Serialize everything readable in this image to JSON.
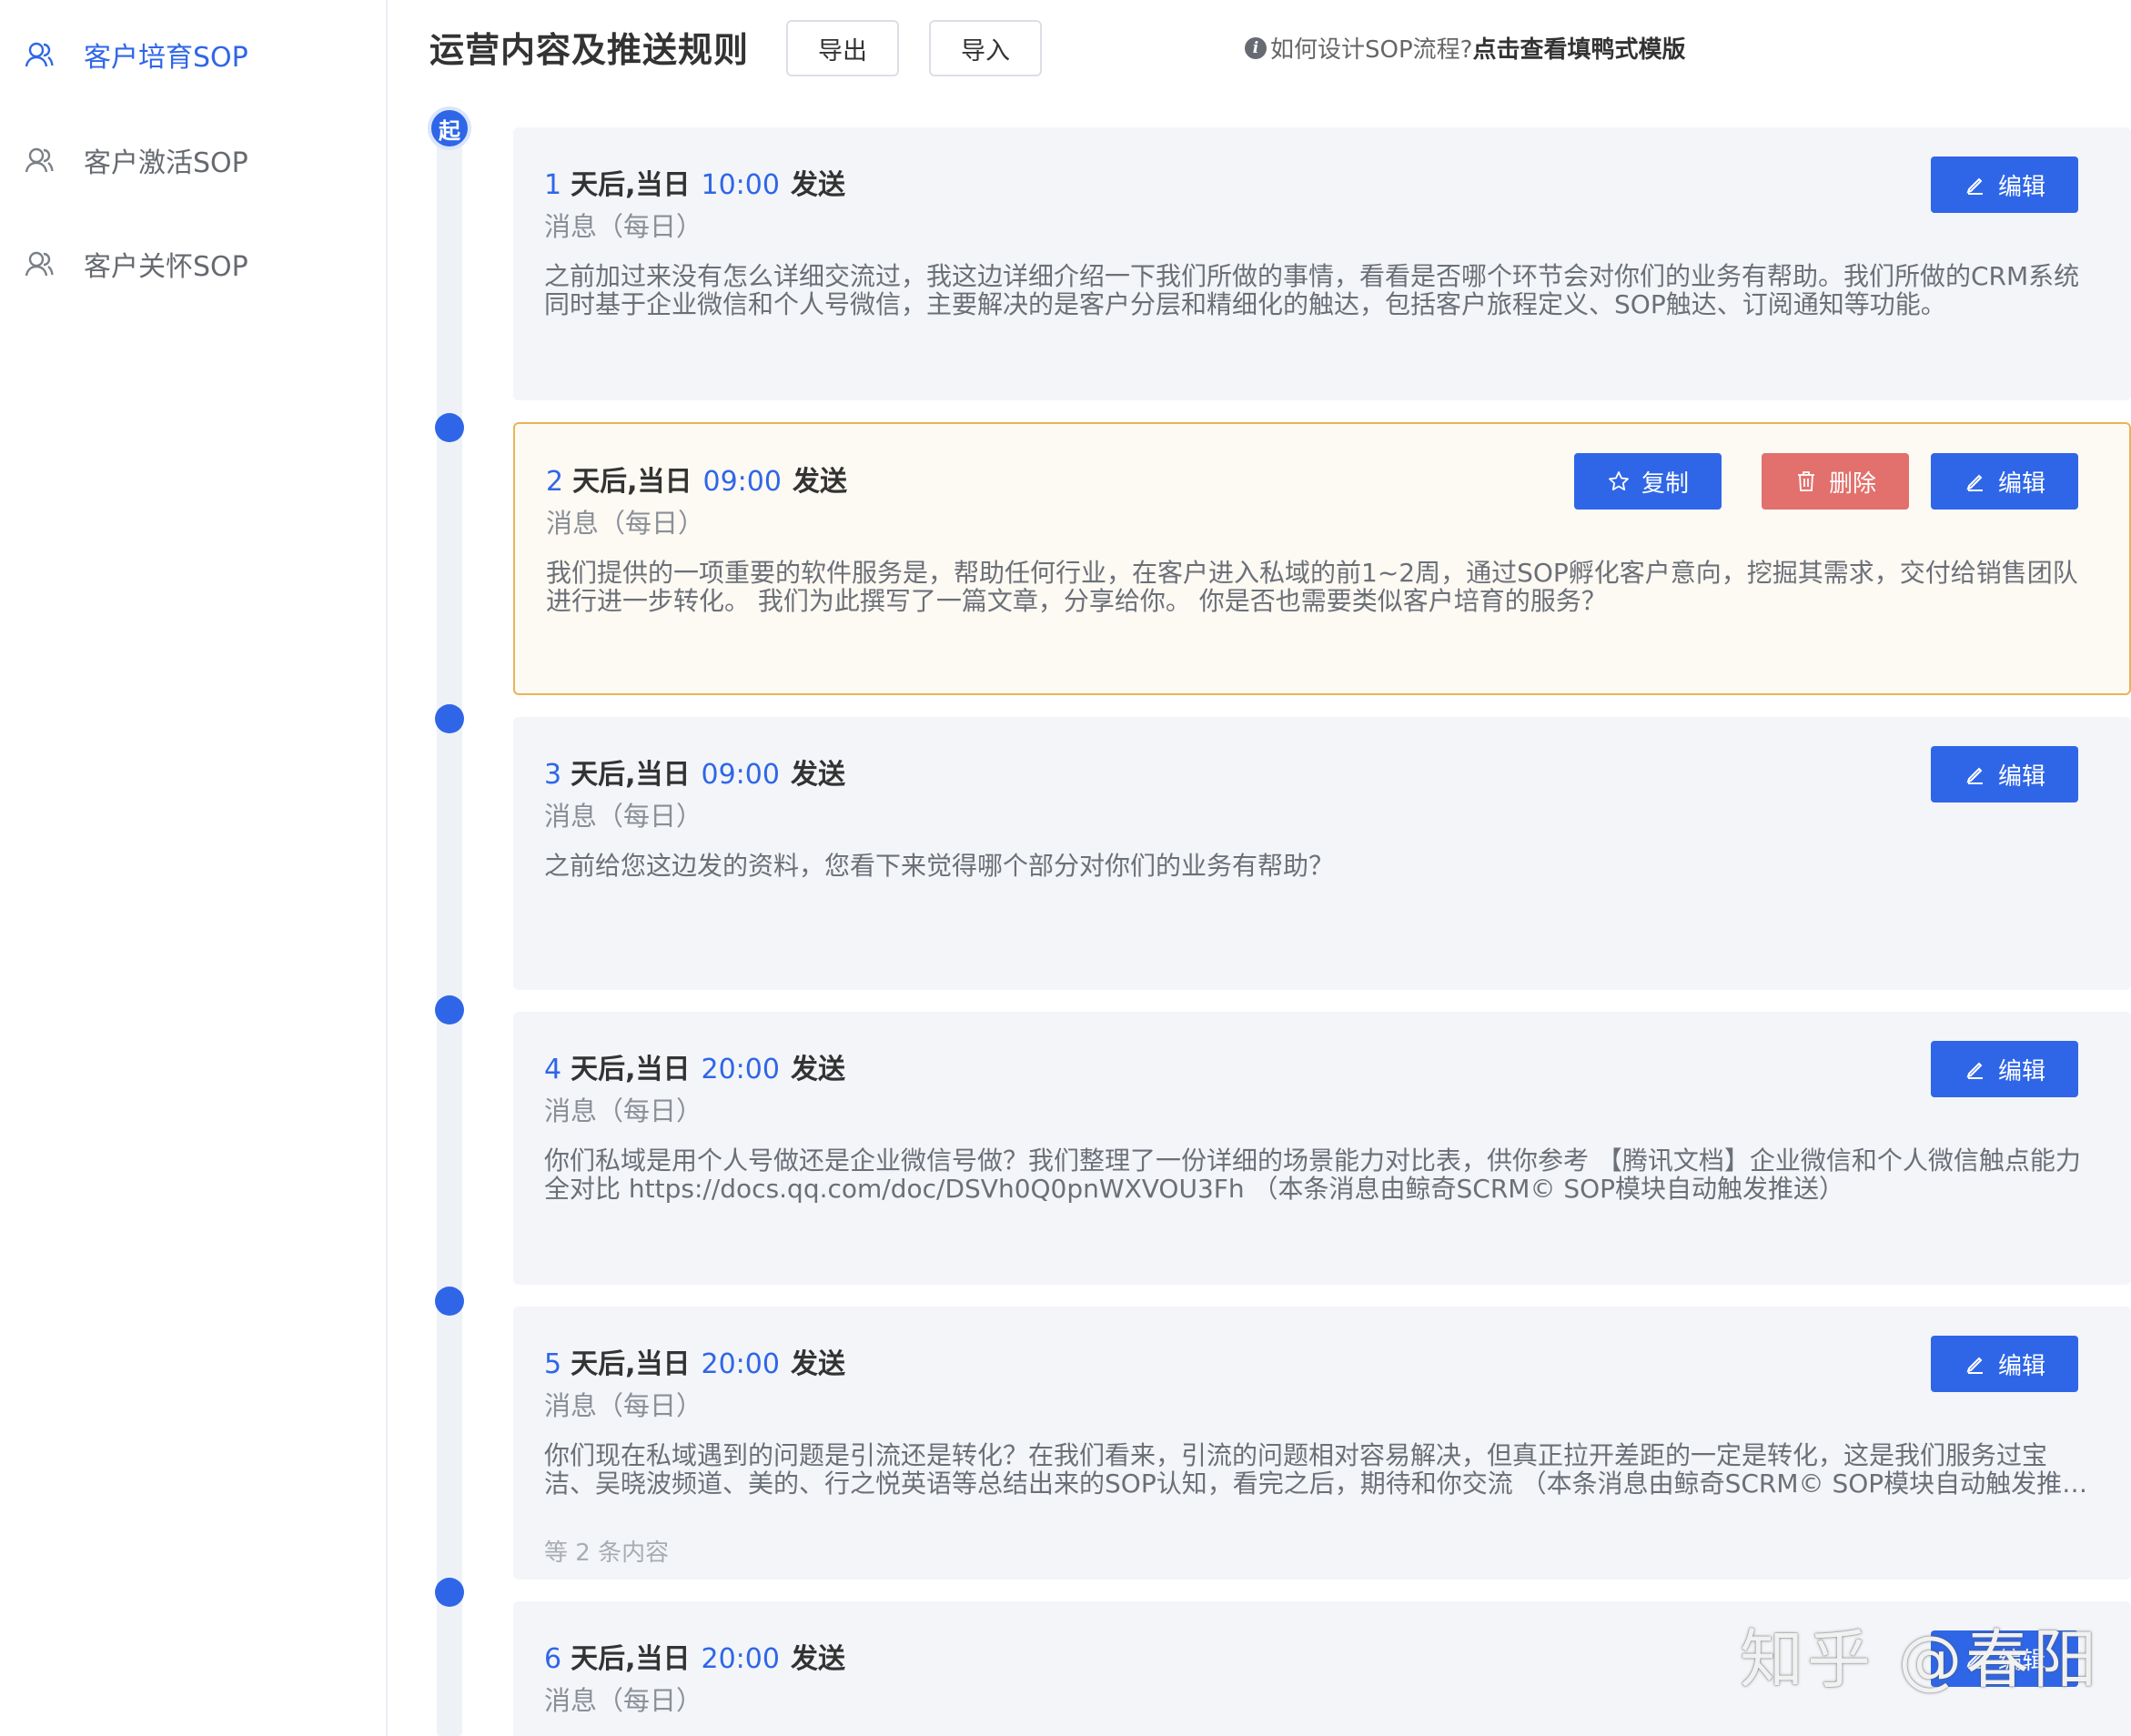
{
  "sidebar": {
    "items": [
      {
        "label": "客户培育SOP",
        "icon": "users-icon",
        "active": true
      },
      {
        "label": "客户激活SOP",
        "icon": "users-icon",
        "active": false
      },
      {
        "label": "客户关怀SOP",
        "icon": "users-icon",
        "active": false
      }
    ]
  },
  "header": {
    "title": "运营内容及推送规则",
    "export_label": "导出",
    "import_label": "导入",
    "hint_text": "如何设计SOP流程?",
    "hint_link": "点击查看填鸭式模版"
  },
  "timeline": {
    "start_label": "起",
    "cards": [
      {
        "num": "1",
        "days_text": "天后,当日",
        "time": "10:00",
        "send": "发送",
        "type": "消息（每日）",
        "content": "之前加过来没有怎么详细交流过，我这边详细介绍一下我们所做的事情，看看是否哪个环节会对你们的业务有帮助。我们所做的CRM系统同时基于企业微信和个人号微信，主要解决的是客户分层和精细化的触达，包括客户旅程定义、SOP触达、订阅通知等功能。",
        "edit_label": "编辑"
      },
      {
        "num": "2",
        "days_text": "天后,当日",
        "time": "09:00",
        "send": "发送",
        "type": "消息（每日）",
        "content": "我们提供的一项重要的软件服务是，帮助任何行业，在客户进入私域的前1~2周，通过SOP孵化客户意向，挖掘其需求，交付给销售团队进行进一步转化。 我们为此撰写了一篇文章，分享给你。 你是否也需要类似客户培育的服务？",
        "copy_label": "复制",
        "delete_label": "删除",
        "edit_label": "编辑"
      },
      {
        "num": "3",
        "days_text": "天后,当日",
        "time": "09:00",
        "send": "发送",
        "type": "消息（每日）",
        "content": "之前给您这边发的资料，您看下来觉得哪个部分对你们的业务有帮助？",
        "edit_label": "编辑"
      },
      {
        "num": "4",
        "days_text": "天后,当日",
        "time": "20:00",
        "send": "发送",
        "type": "消息（每日）",
        "content": "你们私域是用个人号做还是企业微信号做？我们整理了一份详细的场景能力对比表，供你参考 【腾讯文档】企业微信和个人微信触点能力全对比 https://docs.qq.com/doc/DSVh0Q0pnWXVOU3Fh （本条消息由鲸奇SCRM© SOP模块自动触发推送）",
        "edit_label": "编辑"
      },
      {
        "num": "5",
        "days_text": "天后,当日",
        "time": "20:00",
        "send": "发送",
        "type": "消息（每日）",
        "content": "你们现在私域遇到的问题是引流还是转化？在我们看来，引流的问题相对容易解决，但真正拉开差距的一定是转化，这是我们服务过宝洁、吴晓波频道、美的、行之悦英语等总结出来的SOP认知，看完之后，期待和你交流 （本条消息由鲸奇SCRM© SOP模块自动触发推送）",
        "more": "等 2 条内容",
        "edit_label": "编辑"
      },
      {
        "num": "6",
        "days_text": "天后,当日",
        "time": "20:00",
        "send": "发送",
        "type": "消息（每日）",
        "edit_label": "编辑"
      }
    ]
  },
  "watermark": "知乎 @春阳",
  "colors": {
    "accent": "#2f66e8",
    "danger": "#e2706c",
    "selected_border": "#e9b458"
  }
}
